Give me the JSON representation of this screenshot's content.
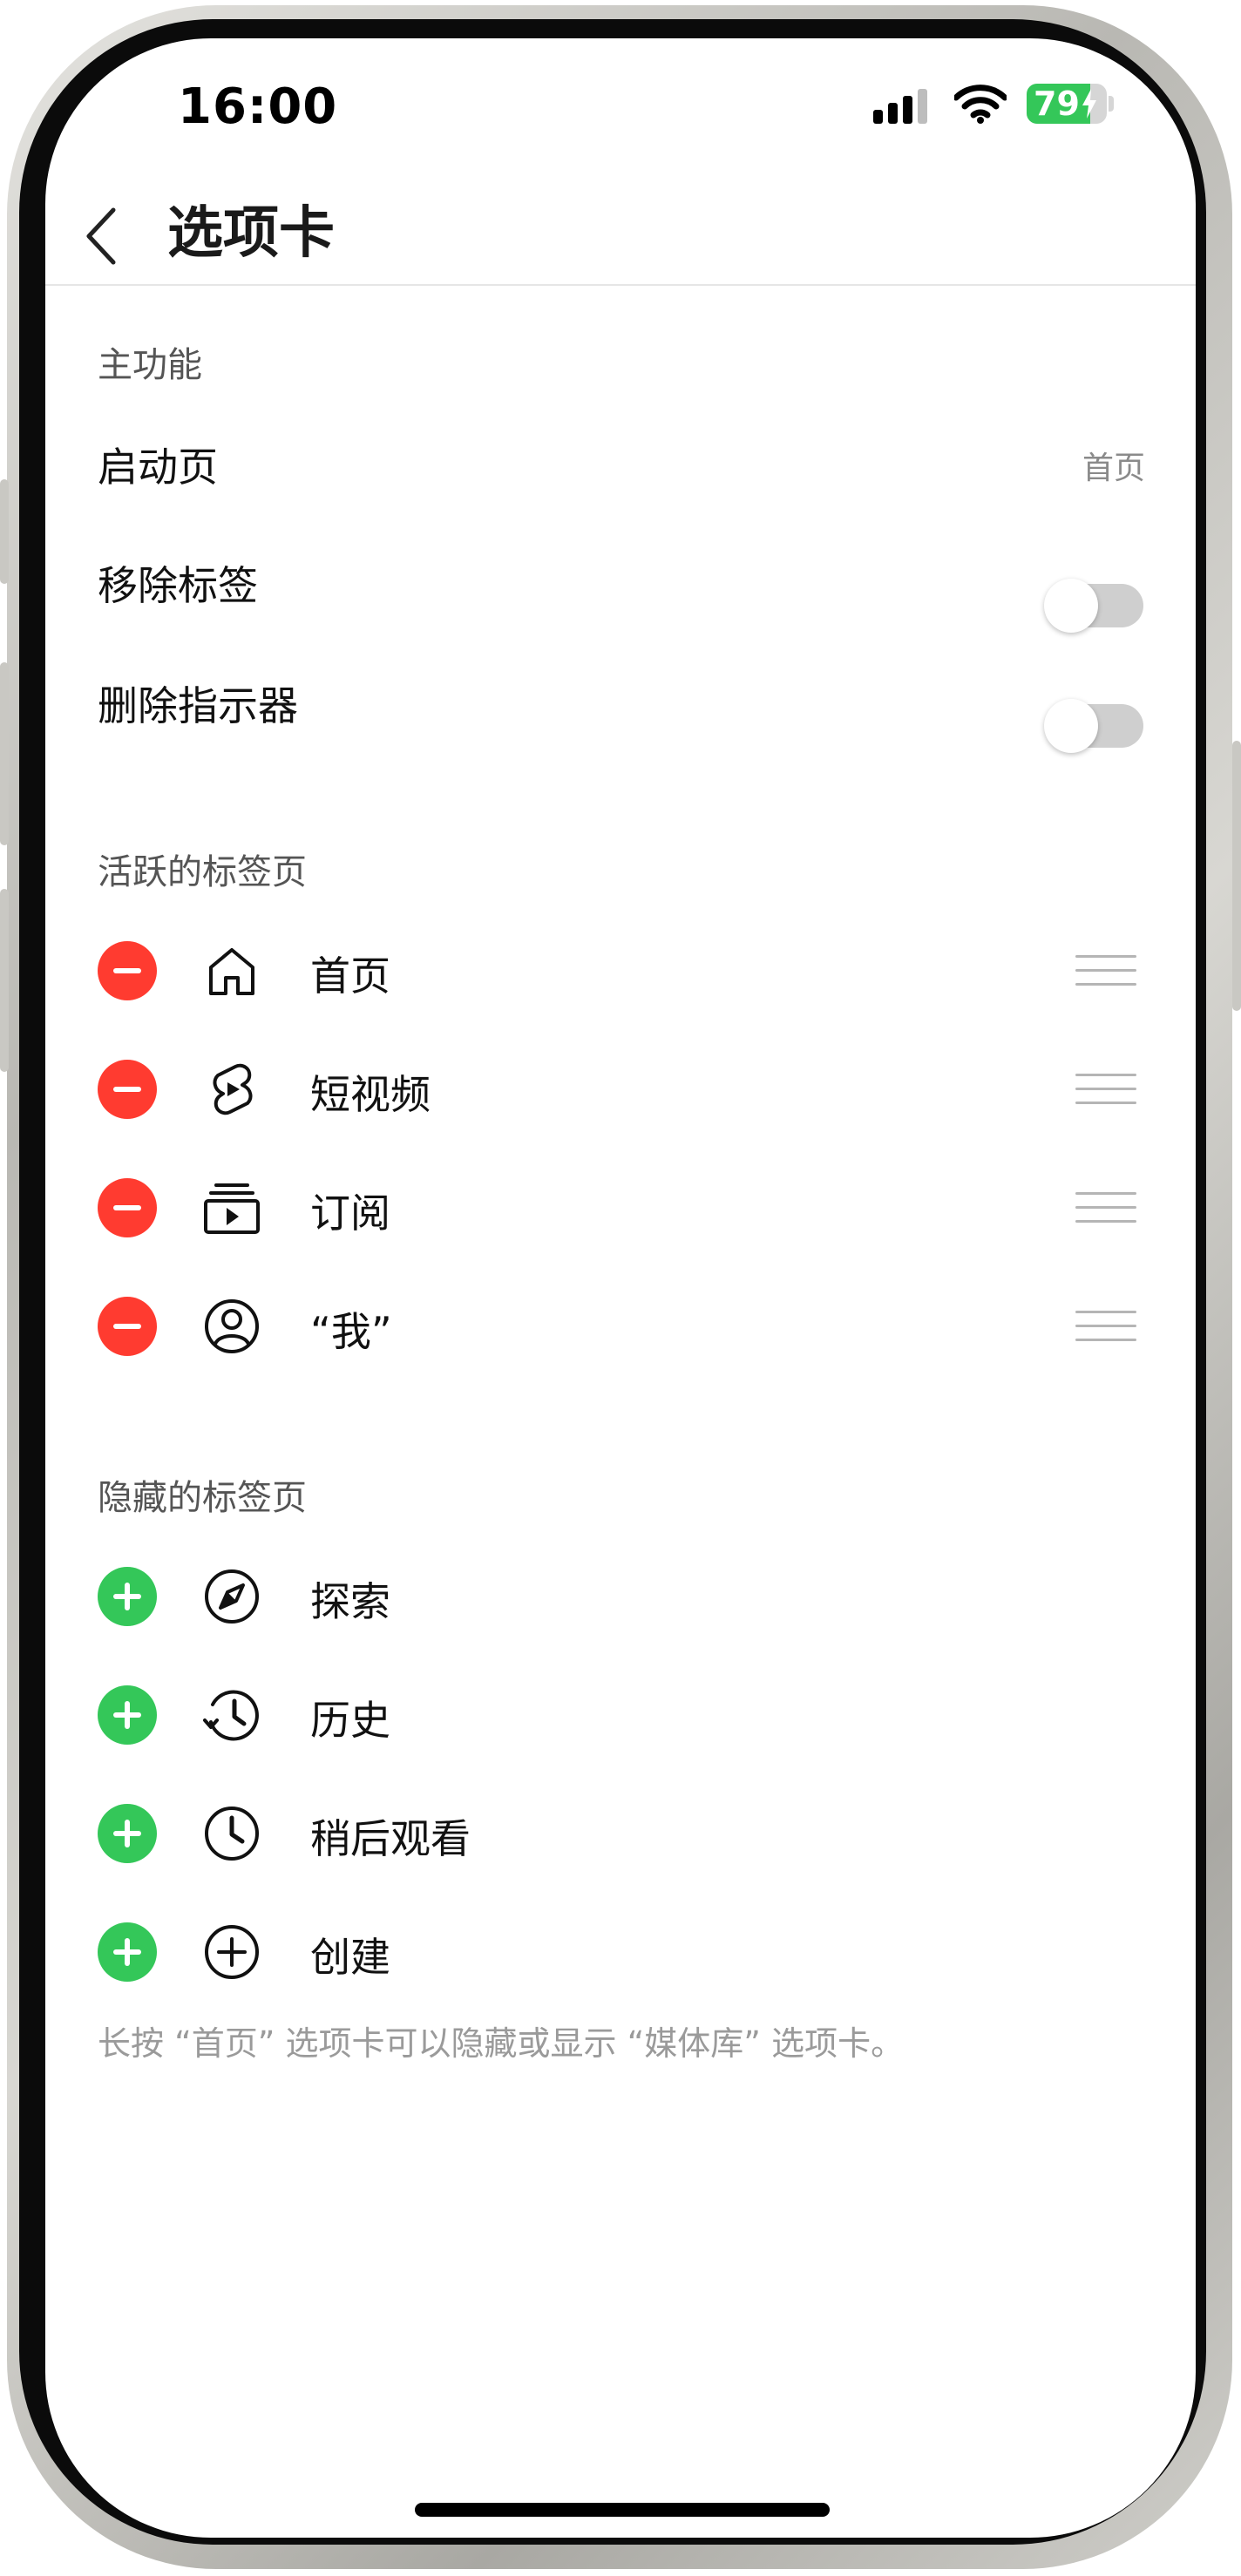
{
  "status_bar": {
    "time": "16:00",
    "battery": "79",
    "battery_level": 0.79
  },
  "header": {
    "title": "选项卡"
  },
  "main_features": {
    "section_title": "主功能",
    "launch_page": {
      "label": "启动页",
      "value": "首页"
    },
    "remove_labels": {
      "label": "移除标签",
      "enabled": false
    },
    "delete_indicator": {
      "label": "删除指示器",
      "enabled": false
    }
  },
  "active_tabs": {
    "section_title": "活跃的标签页",
    "items": [
      {
        "label": "首页",
        "icon": "home-icon"
      },
      {
        "label": "短视频",
        "icon": "shorts-icon"
      },
      {
        "label": "订阅",
        "icon": "subscriptions-icon"
      },
      {
        "label": "“我”",
        "icon": "profile-icon"
      }
    ]
  },
  "hidden_tabs": {
    "section_title": "隐藏的标签页",
    "items": [
      {
        "label": "探索",
        "icon": "compass-icon"
      },
      {
        "label": "历史",
        "icon": "history-icon"
      },
      {
        "label": "稍后观看",
        "icon": "clock-icon"
      },
      {
        "label": "创建",
        "icon": "create-icon"
      }
    ]
  },
  "footnote": "长按 “首页” 选项卡可以隐藏或显示 “媒体库” 选项卡。",
  "colors": {
    "remove": "#ff3b30",
    "add": "#34c759",
    "battery": "#34c759"
  }
}
